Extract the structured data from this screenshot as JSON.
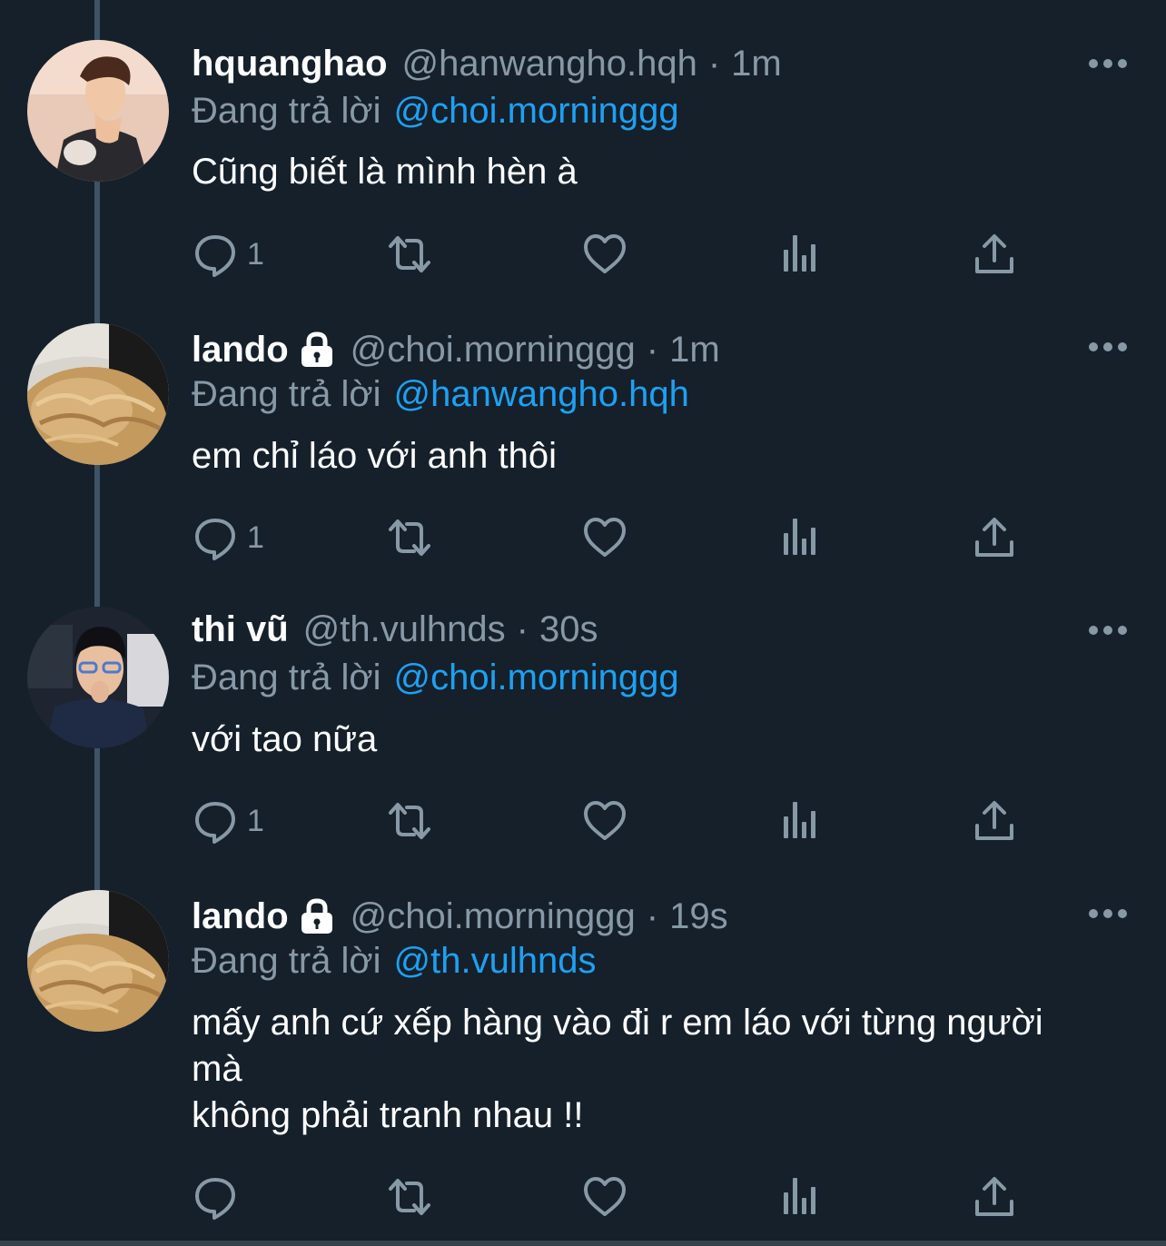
{
  "reply_prefix": "Đang trả lời",
  "colors": {
    "background": "#15202b",
    "secondary_text": "#8899a6",
    "link": "#1da1f2",
    "thread_line": "#3d5466"
  },
  "tweets": [
    {
      "display_name": "hquanghao",
      "handle": "@hanwangho.hqh",
      "time": "1m",
      "reply_to": "@choi.morninggg",
      "text": "Cũng biết là mình hèn à",
      "reply_count": "1",
      "locked": false
    },
    {
      "display_name": "lando",
      "handle": "@choi.morninggg",
      "time": "1m",
      "reply_to": "@hanwangho.hqh",
      "text": "em chỉ láo với anh thôi",
      "reply_count": "1",
      "locked": true
    },
    {
      "display_name": "thi vũ",
      "handle": "@th.vulhnds",
      "time": "30s",
      "reply_to": "@choi.morninggg",
      "text": "với tao nữa",
      "reply_count": "1",
      "locked": false
    },
    {
      "display_name": "lando",
      "handle": "@choi.morninggg",
      "time": "19s",
      "reply_to": "@th.vulhnds",
      "text": "mấy anh cứ xếp hàng vào đi r em láo với từng người\nmà\nkhông phải tranh nhau !!",
      "reply_count": "",
      "locked": true
    }
  ],
  "icons": {
    "reply": "reply-icon",
    "retweet": "retweet-icon",
    "like": "heart-icon",
    "analytics": "analytics-icon",
    "share": "share-icon",
    "more": "more-icon",
    "lock": "lock-icon"
  }
}
